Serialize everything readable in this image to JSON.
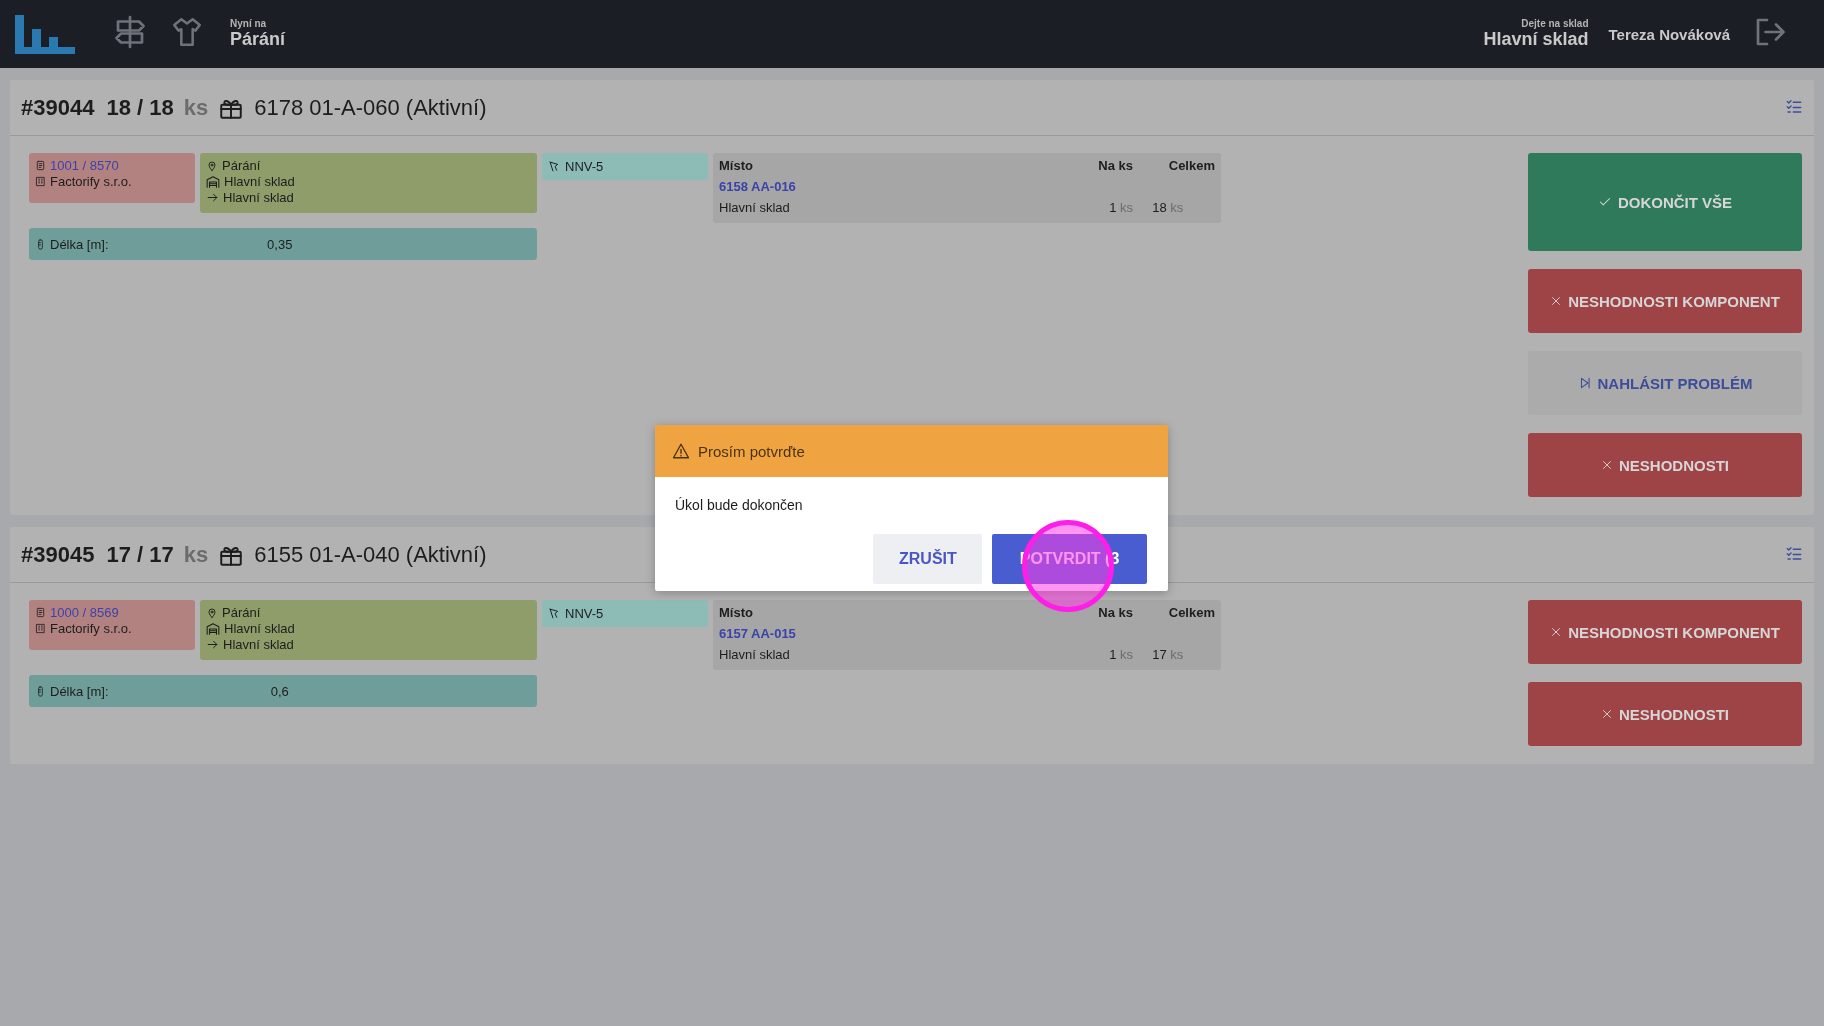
{
  "header": {
    "location_label": "Nyní na",
    "location": "Párání",
    "warehouse_label": "Dejte na sklad",
    "warehouse": "Hlavní sklad",
    "user": "Tereza Nováková"
  },
  "orders": [
    {
      "number": "#39044",
      "qty": "18 / 18",
      "unit": "ks",
      "title": "6178 01-A-060 (Aktivní)",
      "order_link": "1001 / 8570",
      "company": "Factorify s.r.o.",
      "operation": "Párání",
      "warehouse_from": "Hlavní sklad",
      "warehouse_to": "Hlavní sklad",
      "machine": "NNV-5",
      "length_label": "Délka [m]:",
      "length_value": "0,35",
      "columns": [
        "Místo",
        "Na ks",
        "Celkem"
      ],
      "rows": [
        {
          "location": "6158 AA-016",
          "warehouse": "Hlavní sklad",
          "per_piece": "1",
          "per_piece_unit": "ks",
          "total": "18",
          "total_unit": "ks"
        }
      ],
      "actions": [
        {
          "kind": "success",
          "label": "DOKONČIT VŠE"
        },
        {
          "kind": "danger",
          "label": "NESHODNOSTI KOMPONENT"
        },
        {
          "kind": "neutral",
          "label": "NAHLÁSIT PROBLÉM"
        },
        {
          "kind": "danger",
          "label": "NESHODNOSTI"
        }
      ]
    },
    {
      "number": "#39045",
      "qty": "17 / 17",
      "unit": "ks",
      "title": "6155 01-A-040 (Aktivní)",
      "order_link": "1000 / 8569",
      "company": "Factorify s.r.o.",
      "operation": "Párání",
      "warehouse_from": "Hlavní sklad",
      "warehouse_to": "Hlavní sklad",
      "machine": "NNV-5",
      "length_label": "Délka [m]:",
      "length_value": "0,6",
      "columns": [
        "Místo",
        "Na ks",
        "Celkem"
      ],
      "rows": [
        {
          "location": "6157 AA-015",
          "warehouse": "Hlavní sklad",
          "per_piece": "1",
          "per_piece_unit": "ks",
          "total": "17",
          "total_unit": "ks"
        }
      ],
      "actions": [
        {
          "kind": "danger",
          "label": "NESHODNOSTI KOMPONENT"
        },
        {
          "kind": "danger",
          "label": "NESHODNOSTI"
        }
      ]
    }
  ],
  "dialog": {
    "title": "Prosím potvrďte",
    "message": "Úkol bude dokončen",
    "buttons": [
      {
        "kind": "secondary",
        "label": "ZRUŠIT"
      },
      {
        "kind": "primary",
        "label": "POTVRDIT (3"
      }
    ]
  }
}
